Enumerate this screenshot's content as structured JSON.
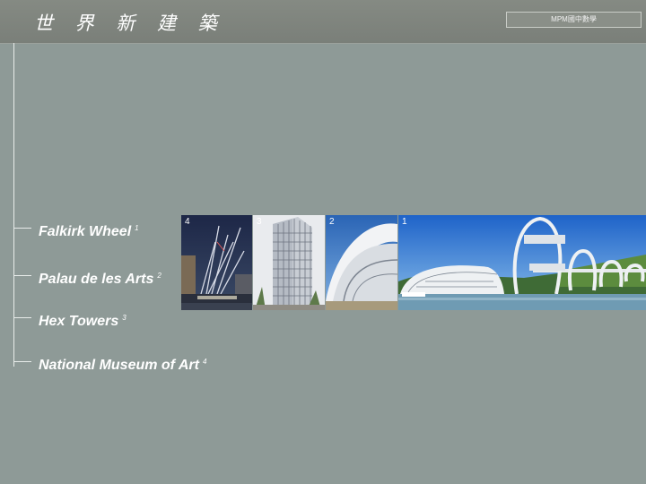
{
  "header": {
    "title": "世 界 新 建 築",
    "badge": "MPM國中數學"
  },
  "list": {
    "items": [
      {
        "label": "Falkirk Wheel",
        "ref": "1"
      },
      {
        "label": "Palau de les Arts",
        "ref": "2"
      },
      {
        "label": "Hex Towers",
        "ref": "3"
      },
      {
        "label": "National Museum of Art",
        "ref": "4"
      }
    ]
  },
  "photos": {
    "numbers": [
      "4",
      "3",
      "2",
      "1"
    ]
  },
  "colors": {
    "background": "#8e9a97",
    "header_bar": "#7f847e",
    "text": "#ffffff",
    "line": "#e8ecea"
  }
}
